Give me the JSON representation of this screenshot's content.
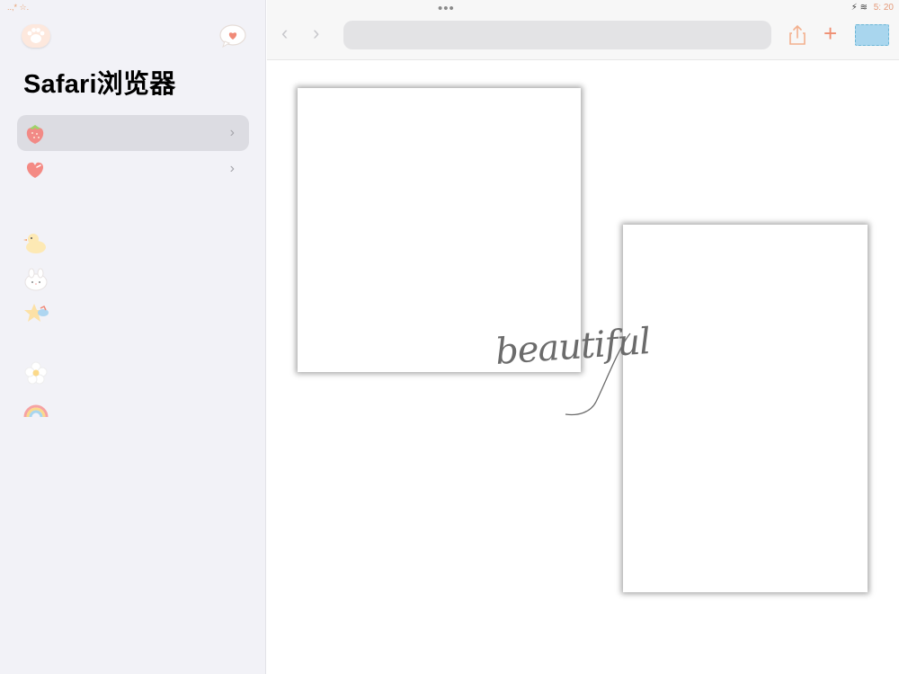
{
  "status_bar": {
    "left_text": "..,* ☆.",
    "time": "5: 20"
  },
  "sidebar": {
    "title": "Safari浏览器",
    "icons": [
      {
        "name": "paw-icon"
      },
      {
        "name": "heart-bubble-icon"
      },
      {
        "name": "strawberry-icon"
      },
      {
        "name": "heart-icon"
      },
      {
        "name": "duck-icon"
      },
      {
        "name": "bunny-icon"
      },
      {
        "name": "star-cloud-icon"
      },
      {
        "name": "flower-icon"
      },
      {
        "name": "rainbow-icon"
      }
    ],
    "rows": [
      {
        "label": "",
        "chevron": "›",
        "selected": true
      },
      {
        "label": "",
        "chevron": "›",
        "selected": false
      }
    ]
  },
  "toolbar": {
    "dots": "•••",
    "back": "‹",
    "forward": "›",
    "address_value": "",
    "plus": "+"
  },
  "content": {
    "watermark": "beautiful"
  },
  "colors": {
    "sidebar_bg": "#f2f2f7",
    "accent": "#ef8f72",
    "tabs_blue": "#a9d6ee"
  }
}
